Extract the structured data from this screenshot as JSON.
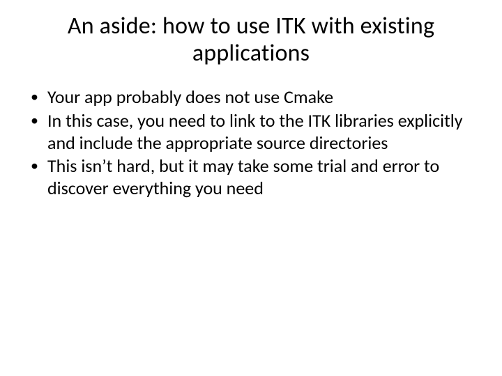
{
  "slide": {
    "title": "An aside: how to use ITK with existing applications",
    "bullets": [
      "Your app probably does not use Cmake",
      "In this case, you need to link to the ITK libraries explicitly and include the appropriate source directories",
      "This isn’t hard, but it may take some trial and error to discover everything you need"
    ]
  }
}
